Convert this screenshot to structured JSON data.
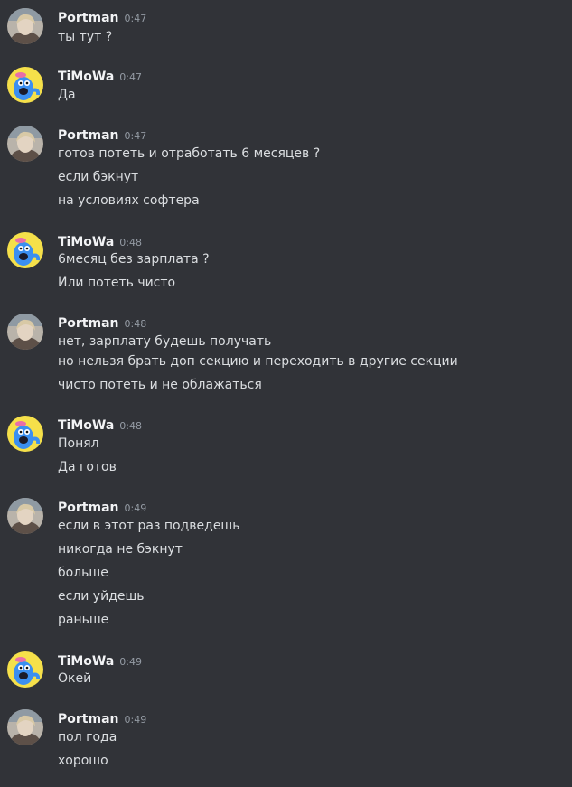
{
  "colors": {
    "background": "#313338",
    "username": "#f2f3f5",
    "timestamp": "#949ba4",
    "text": "#dbdee1",
    "timowa_avatar_bg": "#f5e04a",
    "timowa_avatar_char": "#3b8ff0",
    "portman_avatar_bg": "#b9b3aa"
  },
  "groups": [
    {
      "author": "Portman",
      "avatar": "portman-avatar",
      "time": "0:47",
      "messages": [
        "ты тут ?"
      ]
    },
    {
      "author": "TiMoWa",
      "avatar": "timowa-avatar",
      "time": "0:47",
      "messages": [
        "Да"
      ]
    },
    {
      "author": "Portman",
      "avatar": "portman-avatar",
      "time": "0:47",
      "messages": [
        "готов потеть и отработать 6 месяцев ?",
        "если бэкнут",
        "на условиях софтера"
      ]
    },
    {
      "author": "TiMoWa",
      "avatar": "timowa-avatar",
      "time": "0:48",
      "messages": [
        "6месяц без зарплата ?",
        "Или потеть чисто"
      ]
    },
    {
      "author": "Portman",
      "avatar": "portman-avatar",
      "time": "0:48",
      "messages": [
        "нет, зарплату будешь получать",
        "но нельзя брать доп секцию и переходить в другие секции",
        "чисто потеть и не облажаться"
      ]
    },
    {
      "author": "TiMoWa",
      "avatar": "timowa-avatar",
      "time": "0:48",
      "messages": [
        "Понял",
        "Да готов"
      ]
    },
    {
      "author": "Portman",
      "avatar": "portman-avatar",
      "time": "0:49",
      "messages": [
        "если в этот раз подведешь",
        "никогда не бэкнут",
        "больше",
        "если уйдешь",
        "раньше"
      ]
    },
    {
      "author": "TiMoWa",
      "avatar": "timowa-avatar",
      "time": "0:49",
      "messages": [
        "Окей"
      ]
    },
    {
      "author": "Portman",
      "avatar": "portman-avatar",
      "time": "0:49",
      "messages": [
        "пол года",
        "хорошо"
      ]
    }
  ]
}
